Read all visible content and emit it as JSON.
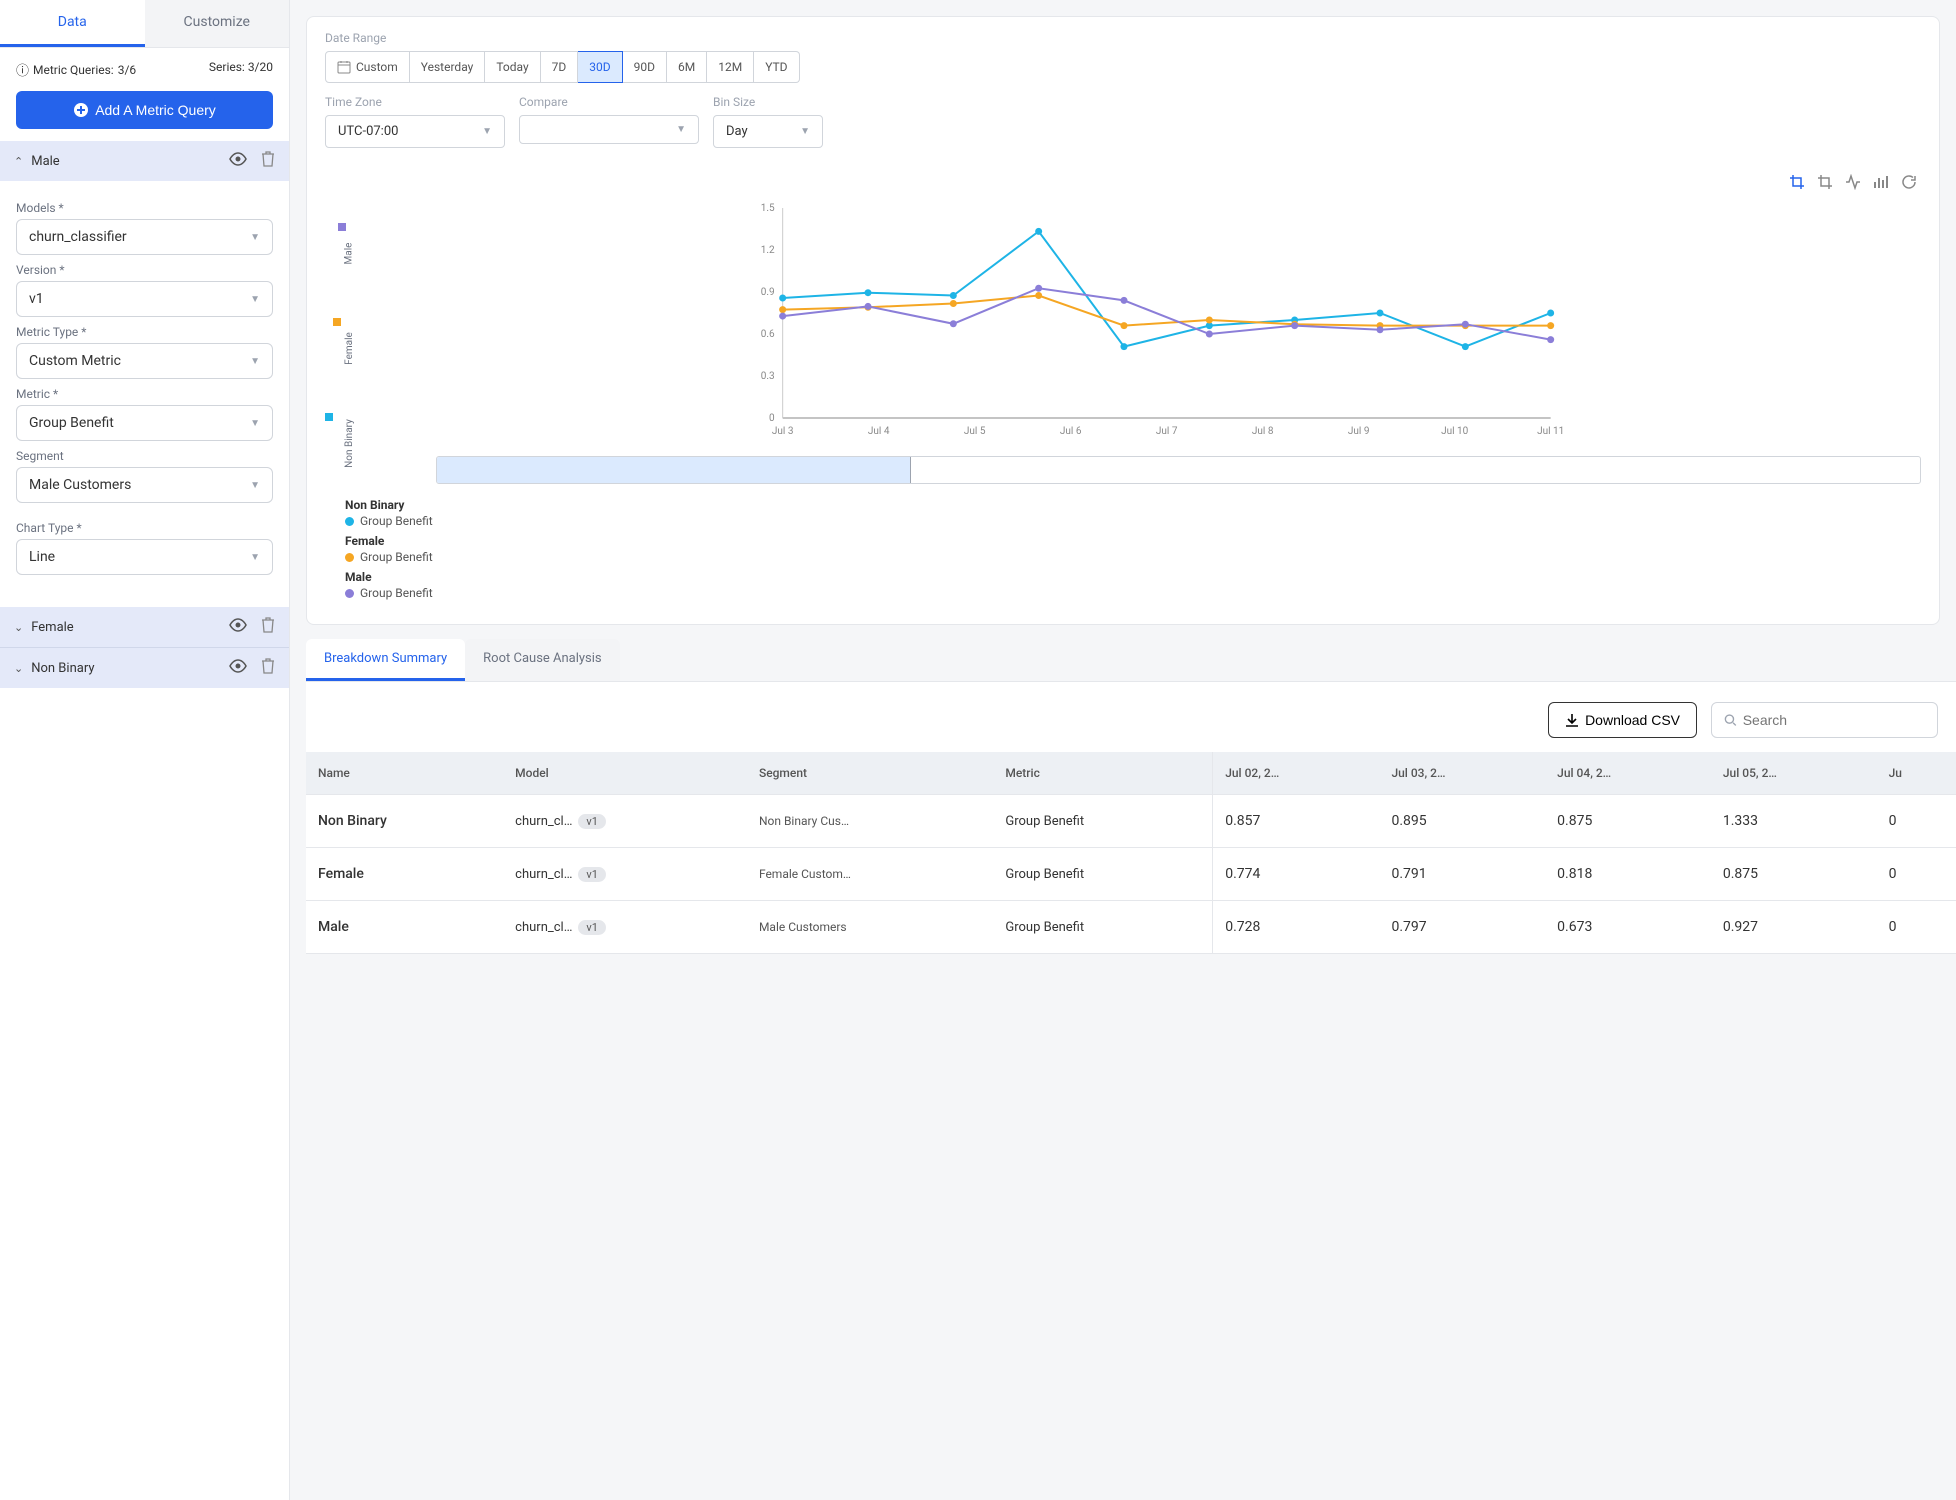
{
  "sidebar": {
    "tabs": {
      "data": "Data",
      "customize": "Customize"
    },
    "metric_queries_label": "Metric Queries:",
    "metric_queries_value": "3/6",
    "series_label": "Series:",
    "series_value": "3/20",
    "add_button": "Add A Metric Query",
    "group_male": "Male",
    "group_female": "Female",
    "group_nonbinary": "Non Binary",
    "fields": {
      "models_label": "Models *",
      "models_value": "churn_classifier",
      "version_label": "Version *",
      "version_value": "v1",
      "metric_type_label": "Metric Type *",
      "metric_type_value": "Custom Metric",
      "metric_label": "Metric *",
      "metric_value": "Group Benefit",
      "segment_label": "Segment",
      "segment_value": "Male Customers",
      "chart_type_label": "Chart Type *",
      "chart_type_value": "Line"
    }
  },
  "controls": {
    "date_range_label": "Date Range",
    "custom": "Custom",
    "yesterday": "Yesterday",
    "today": "Today",
    "d7": "7D",
    "d30": "30D",
    "d90": "90D",
    "m6": "6M",
    "m12": "12M",
    "ytd": "YTD",
    "timezone_label": "Time Zone",
    "timezone_value": "UTC-07:00",
    "compare_label": "Compare",
    "compare_value": "",
    "binsize_label": "Bin Size",
    "binsize_value": "Day"
  },
  "chart_data": {
    "type": "line",
    "x": [
      "Jul 3",
      "Jul 4",
      "Jul 5",
      "Jul 6",
      "Jul 7",
      "Jul 8",
      "Jul 9",
      "Jul 10",
      "Jul 11"
    ],
    "ylim": [
      0,
      1.5
    ],
    "yticks": [
      0,
      0.3,
      0.6,
      0.9,
      1.2,
      1.5
    ],
    "series": [
      {
        "name": "Non Binary — Group Benefit",
        "color": "#1eb4e6",
        "values": [
          0.857,
          0.895,
          0.875,
          1.333,
          0.51,
          0.66,
          0.7,
          0.75,
          0.51,
          0.75
        ]
      },
      {
        "name": "Female — Group Benefit",
        "color": "#f5a623",
        "values": [
          0.774,
          0.791,
          0.818,
          0.875,
          0.66,
          0.7,
          0.67,
          0.66,
          0.66,
          0.66
        ]
      },
      {
        "name": "Male — Group Benefit",
        "color": "#8b7ed8",
        "values": [
          0.728,
          0.797,
          0.673,
          0.927,
          0.84,
          0.6,
          0.66,
          0.63,
          0.67,
          0.56
        ]
      }
    ]
  },
  "legend": {
    "g1_title": "Non Binary",
    "g1_item": "Group Benefit",
    "g2_title": "Female",
    "g2_item": "Group Benefit",
    "g3_title": "Male",
    "g3_item": "Group Benefit"
  },
  "subtabs": {
    "breakdown": "Breakdown Summary",
    "root": "Root Cause Analysis"
  },
  "table_tools": {
    "download": "Download CSV",
    "search_placeholder": "Search"
  },
  "table": {
    "headers": {
      "name": "Name",
      "model": "Model",
      "segment": "Segment",
      "metric": "Metric",
      "c1": "Jul 02, 2…",
      "c2": "Jul 03, 2…",
      "c3": "Jul 04, 2…",
      "c4": "Jul 05, 2…",
      "c5": "Ju"
    },
    "rows": [
      {
        "name": "Non Binary",
        "model": "churn_cl…",
        "version": "v1",
        "segment": "Non Binary Cus…",
        "metric": "Group Benefit",
        "c1": "0.857",
        "c2": "0.895",
        "c3": "0.875",
        "c4": "1.333",
        "c5": "0"
      },
      {
        "name": "Female",
        "model": "churn_cl…",
        "version": "v1",
        "segment": "Female Custom…",
        "metric": "Group Benefit",
        "c1": "0.774",
        "c2": "0.791",
        "c3": "0.818",
        "c4": "0.875",
        "c5": "0"
      },
      {
        "name": "Male",
        "model": "churn_cl…",
        "version": "v1",
        "segment": "Male Customers",
        "metric": "Group Benefit",
        "c1": "0.728",
        "c2": "0.797",
        "c3": "0.673",
        "c4": "0.927",
        "c5": "0"
      }
    ]
  },
  "colors": {
    "nonbinary": "#1eb4e6",
    "female": "#f5a623",
    "male": "#8b7ed8"
  }
}
